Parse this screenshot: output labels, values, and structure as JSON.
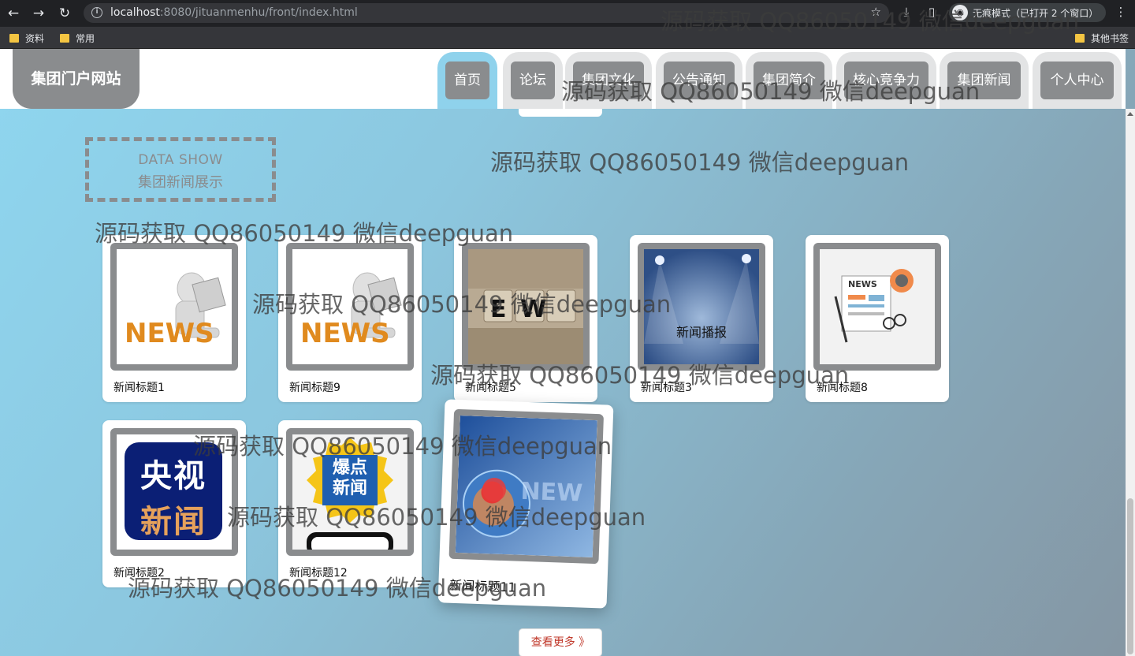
{
  "browser": {
    "url_host": "localhost",
    "url_rest": ":8080/jituanmenhu/front/index.html",
    "incognito_label": "无痕模式（已打开 2 个窗口）",
    "bookmarks": [
      "资料",
      "常用"
    ],
    "other_bookmarks": "其他书签"
  },
  "header": {
    "logo": "集团门户网站",
    "nav": [
      "首页",
      "论坛",
      "集团文化",
      "公告通知",
      "集团简介",
      "核心竞争力",
      "集团新闻",
      "个人中心"
    ]
  },
  "section": {
    "title_en": "DATA SHOW",
    "title_cn": "集团新闻展示"
  },
  "news": [
    {
      "title": "新闻标题1",
      "image": "news-3d-man-reading"
    },
    {
      "title": "新闻标题9",
      "image": "news-3d-man-reading"
    },
    {
      "title": "新闻标题5",
      "image": "new-letter-blocks"
    },
    {
      "title": "新闻标题3",
      "image": "news-broadcast-stage",
      "caption": "新闻播报"
    },
    {
      "title": "新闻标题8",
      "image": "newspaper-illustration",
      "caption": "NEWS"
    },
    {
      "title": "新闻标题2",
      "image": "cctv-news-logo",
      "caption_lines": [
        "央视",
        "新闻"
      ]
    },
    {
      "title": "新闻标题12",
      "image": "breaking-news-phone",
      "caption_lines": [
        "爆点",
        "新闻"
      ]
    },
    {
      "title": "新闻标题11",
      "image": "news-globe-blue",
      "caption": "NEW"
    }
  ],
  "more_button": "查看更多 》",
  "watermarks": [
    "源码获取 QQ86050149 微信deepguan",
    "源码获取 QQ86050149 微信deepguan",
    "源码获取 QQ86050149 微信deepguan",
    "源码获取 QQ86050149 微信deepguan",
    "源码获取 QQ86050149 微信deepguan",
    "源码获取 QQ86050149 微信deepguan",
    "源码获取 QQ86050149 微信deepguan",
    "源码获取 QQ86050149 微信deepguan",
    "源码获取 QQ86050149 微信deepguan",
    "源码获取 QQ86050149 微信deepguan"
  ]
}
